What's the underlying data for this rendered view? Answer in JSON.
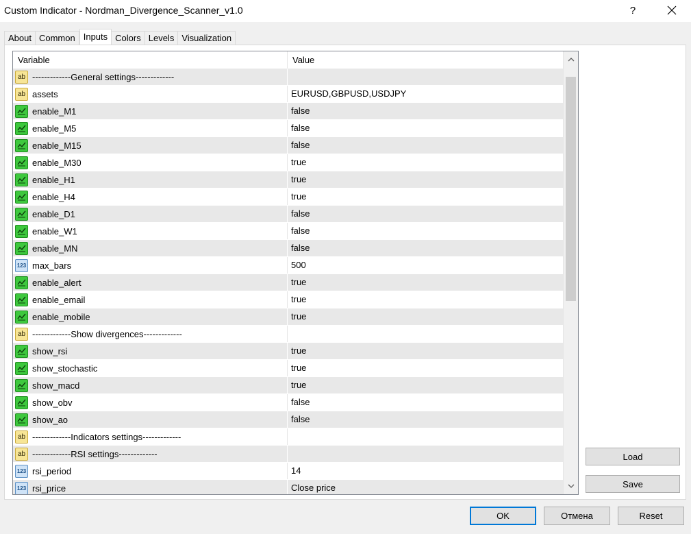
{
  "window": {
    "title": "Custom Indicator - Nordman_Divergence_Scanner_v1.0",
    "help_label": "?",
    "close_icon": "close-icon"
  },
  "tabs": [
    {
      "label": "About"
    },
    {
      "label": "Common"
    },
    {
      "label": "Inputs"
    },
    {
      "label": "Colors"
    },
    {
      "label": "Levels"
    },
    {
      "label": "Visualization"
    }
  ],
  "grid": {
    "col_variable": "Variable",
    "col_value": "Value",
    "rows": [
      {
        "type": "string",
        "icon": "ab",
        "variable": "-------------General settings-------------",
        "value": ""
      },
      {
        "type": "string",
        "icon": "ab",
        "variable": "assets",
        "value": "EURUSD,GBPUSD,USDJPY"
      },
      {
        "type": "bool",
        "icon": "bool",
        "variable": "enable_M1",
        "value": "false"
      },
      {
        "type": "bool",
        "icon": "bool",
        "variable": "enable_M5",
        "value": "false"
      },
      {
        "type": "bool",
        "icon": "bool",
        "variable": "enable_M15",
        "value": "false"
      },
      {
        "type": "bool",
        "icon": "bool",
        "variable": "enable_M30",
        "value": "true"
      },
      {
        "type": "bool",
        "icon": "bool",
        "variable": "enable_H1",
        "value": "true"
      },
      {
        "type": "bool",
        "icon": "bool",
        "variable": "enable_H4",
        "value": "true"
      },
      {
        "type": "bool",
        "icon": "bool",
        "variable": "enable_D1",
        "value": "false"
      },
      {
        "type": "bool",
        "icon": "bool",
        "variable": "enable_W1",
        "value": "false"
      },
      {
        "type": "bool",
        "icon": "bool",
        "variable": "enable_MN",
        "value": "false"
      },
      {
        "type": "int",
        "icon": "123",
        "variable": "max_bars",
        "value": "500"
      },
      {
        "type": "bool",
        "icon": "bool",
        "variable": "enable_alert",
        "value": "true"
      },
      {
        "type": "bool",
        "icon": "bool",
        "variable": "enable_email",
        "value": "true"
      },
      {
        "type": "bool",
        "icon": "bool",
        "variable": "enable_mobile",
        "value": "true"
      },
      {
        "type": "string",
        "icon": "ab",
        "variable": "-------------Show divergences-------------",
        "value": ""
      },
      {
        "type": "bool",
        "icon": "bool",
        "variable": "show_rsi",
        "value": "true"
      },
      {
        "type": "bool",
        "icon": "bool",
        "variable": "show_stochastic",
        "value": "true"
      },
      {
        "type": "bool",
        "icon": "bool",
        "variable": "show_macd",
        "value": "true"
      },
      {
        "type": "bool",
        "icon": "bool",
        "variable": "show_obv",
        "value": "false"
      },
      {
        "type": "bool",
        "icon": "bool",
        "variable": "show_ao",
        "value": "false"
      },
      {
        "type": "string",
        "icon": "ab",
        "variable": "-------------Indicators settings-------------",
        "value": ""
      },
      {
        "type": "string",
        "icon": "ab",
        "variable": "-------------RSI settings-------------",
        "value": ""
      },
      {
        "type": "int",
        "icon": "123",
        "variable": "rsi_period",
        "value": "14"
      },
      {
        "type": "int",
        "icon": "123",
        "variable": "rsi_price",
        "value": "Close price"
      }
    ]
  },
  "side_buttons": {
    "load": "Load",
    "save": "Save"
  },
  "footer_buttons": {
    "ok": "OK",
    "cancel": "Отмена",
    "reset": "Reset"
  },
  "colors": {
    "accent": "#0078d7",
    "alt_row": "#e8e8e8",
    "bool_icon": "#3ec83e",
    "string_icon": "#f7e596",
    "int_icon": "#cfe3f7"
  }
}
